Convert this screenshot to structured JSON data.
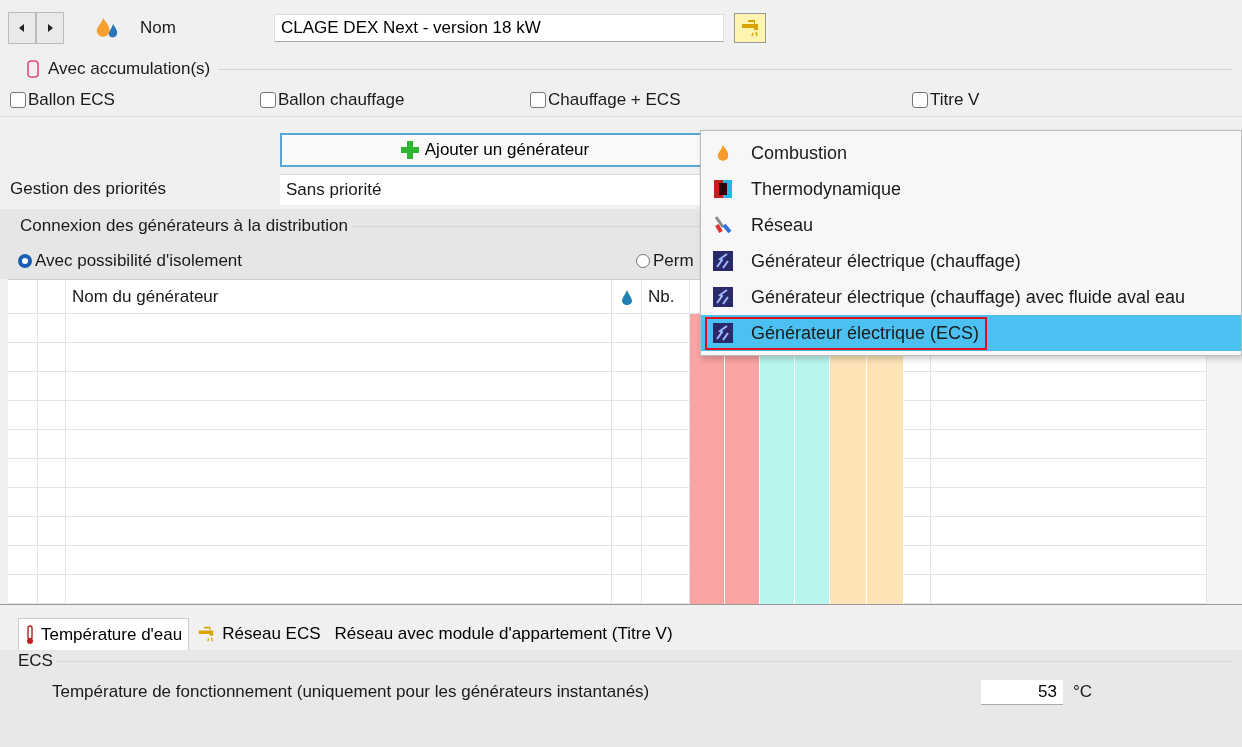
{
  "header": {
    "name_label": "Nom",
    "name_value": "CLAGE DEX Next - version 18 kW"
  },
  "accumulation": {
    "title": "Avec accumulation(s)",
    "options": [
      {
        "label": "Ballon ECS",
        "checked": false
      },
      {
        "label": "Ballon chauffage",
        "checked": false
      },
      {
        "label": "Chauffage + ECS",
        "checked": false
      },
      {
        "label": "Titre V",
        "checked": false
      }
    ]
  },
  "add_button": {
    "label": "Ajouter un générateur"
  },
  "priority": {
    "label": "Gestion des priorités",
    "value": "Sans priorité"
  },
  "connection": {
    "title": "Connexion des générateurs à la distribution",
    "options": [
      {
        "label": "Avec possibilité d'isolement",
        "selected": true
      },
      {
        "label": "Perm",
        "selected": false
      }
    ]
  },
  "table": {
    "columns": [
      "Nom du générateur",
      "Nb."
    ],
    "bands": [
      {
        "color": "#f9a3a3"
      },
      {
        "color": "#f9a3a3"
      },
      {
        "color": "#b9f5ef"
      },
      {
        "color": "#b9f5ef"
      },
      {
        "color": "#fde3b6"
      },
      {
        "color": "#fde3b6"
      }
    ]
  },
  "menu": {
    "items": [
      {
        "label": "Combustion",
        "kind": "flame",
        "selected": false
      },
      {
        "label": "Thermodynamique",
        "kind": "thermo",
        "selected": false
      },
      {
        "label": "Réseau",
        "kind": "network",
        "selected": false
      },
      {
        "label": "Générateur électrique (chauffage)",
        "kind": "electric",
        "selected": false
      },
      {
        "label": "Générateur électrique (chauffage) avec fluide aval eau",
        "kind": "electric",
        "selected": false
      },
      {
        "label": "Générateur électrique (ECS)",
        "kind": "electric",
        "selected": true
      }
    ]
  },
  "tabs": [
    {
      "label": "Température d'eau",
      "kind": "thermometer",
      "selected": true
    },
    {
      "label": "Réseau ECS",
      "kind": "tap",
      "selected": false
    },
    {
      "label": "Réseau avec module d'appartement (Titre V)",
      "kind": "none",
      "selected": false
    }
  ],
  "ecs": {
    "title": "ECS",
    "label": "Température de fonctionnement (uniquement pour les générateurs instantanés)",
    "value": "53",
    "unit": "°C"
  }
}
